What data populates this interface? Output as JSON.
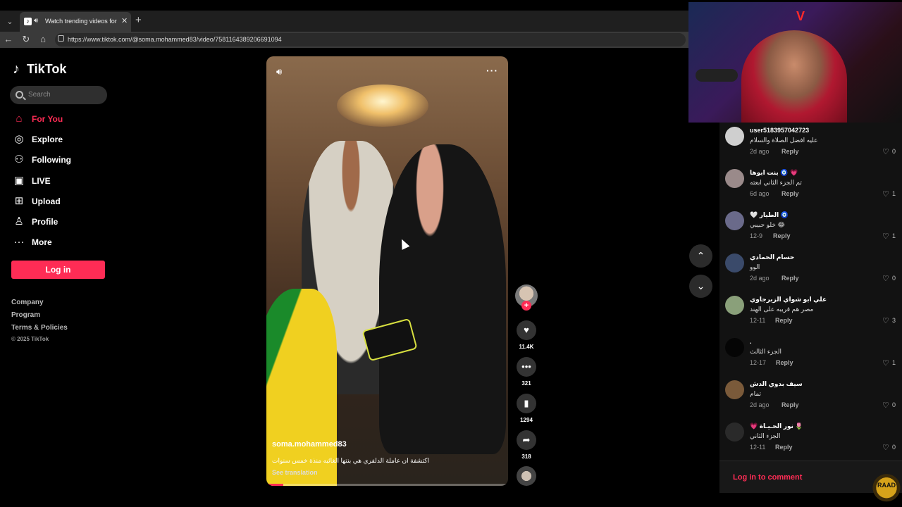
{
  "browser": {
    "tab_title": "Watch trending videos for you",
    "url": "https://www.tiktok.com/@soma.mohammed83/video/7581164389206691094",
    "new_tab_icon": "+",
    "close_icon": "✕"
  },
  "sidebar": {
    "brand": "TikTok",
    "search_placeholder": "Search",
    "items": [
      {
        "label": "For You",
        "icon": "home-icon",
        "active": true
      },
      {
        "label": "Explore",
        "icon": "compass-icon"
      },
      {
        "label": "Following",
        "icon": "user-plus-icon"
      },
      {
        "label": "LIVE",
        "icon": "live-tv-icon"
      },
      {
        "label": "Upload",
        "icon": "upload-icon"
      },
      {
        "label": "Profile",
        "icon": "profile-icon"
      },
      {
        "label": "More",
        "icon": "more-icon"
      }
    ],
    "login_label": "Log in",
    "footer_links": [
      "Company",
      "Program",
      "Terms & Policies"
    ],
    "copyright": "© 2025 TikTok"
  },
  "video": {
    "author": "soma.mohammed83",
    "caption": "اكتشفة ان عاملة الدلفري هي بنتها الغائبه منذة خمس سنوات",
    "see_translation": "See translation",
    "progress": 0.07
  },
  "actions": {
    "likes": "11.4K",
    "comments": "321",
    "saves": "1294",
    "shares": "318"
  },
  "comments": [
    {
      "name": "user5183957042723",
      "text": "عليه افضل الصلاة والسلام",
      "date": "2d ago",
      "reply": "Reply",
      "likes": "0"
    },
    {
      "name": "بنت ابوها 🧿 💗",
      "text": "تم الجزء الثاني ابعته",
      "date": "6d ago",
      "reply": "Reply",
      "likes": "1"
    },
    {
      "name": "🤍 الطيار 🧿",
      "text": "خلو حبيبي 😂",
      "date": "12-9",
      "reply": "Reply",
      "likes": "1"
    },
    {
      "name": "حسام الحمادي",
      "text": "الوو",
      "date": "2d ago",
      "reply": "Reply",
      "likes": "0"
    },
    {
      "name": "علي ابو شواي الزبرجاوي",
      "text": "مصر هم قريبه على الهند",
      "date": "12-11",
      "reply": "Reply",
      "likes": "3"
    },
    {
      "name": ".",
      "text": "الجزء الثالث",
      "date": "12-17",
      "reply": "Reply",
      "likes": "1"
    },
    {
      "name": "سيف بدوي الدش",
      "text": "تمام",
      "date": "2d ago",
      "reply": "Reply",
      "likes": "0"
    },
    {
      "name": "💗 نور الحـيـاة 🌷",
      "text": "الجزء الثاني",
      "date": "12-11",
      "reply": "Reply",
      "likes": "0"
    }
  ],
  "comment_login": "Log in to comment",
  "watermark": "RAAD",
  "colors": {
    "accent": "#fe2c55"
  }
}
